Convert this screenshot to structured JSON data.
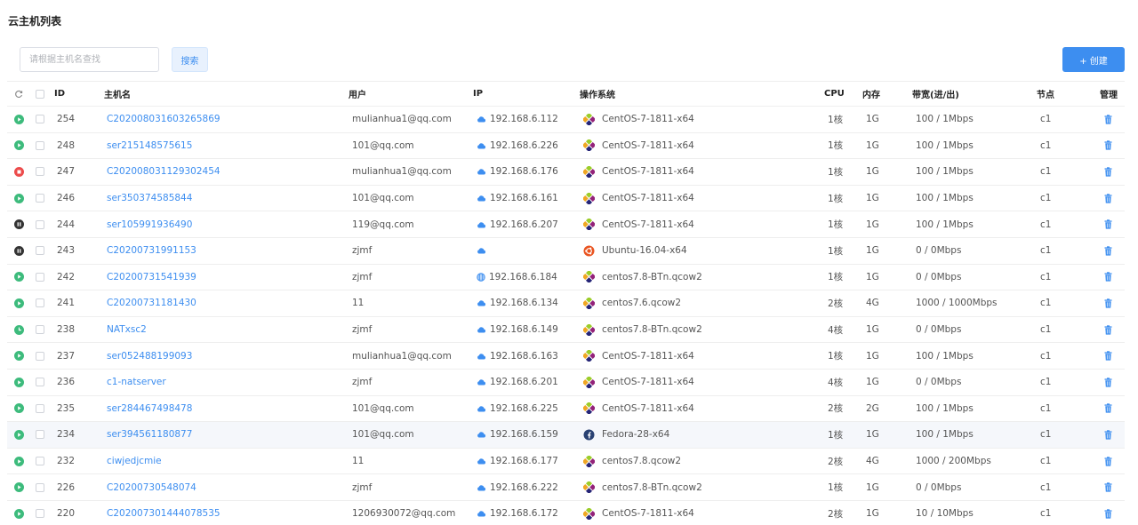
{
  "page": {
    "title": "云主机列表"
  },
  "toolbar": {
    "search_placeholder": "请根据主机名查找",
    "search_value": "",
    "search_label": "搜索",
    "create_label": "+ 创建"
  },
  "columns": {
    "id": "ID",
    "name": "主机名",
    "user": "用户",
    "ip": "IP",
    "os": "操作系统",
    "cpu": "CPU",
    "mem": "内存",
    "bandwidth": "带宽(进/出)",
    "node": "节点",
    "manage": "管理"
  },
  "colors": {
    "accent": "#3d8ef0",
    "running": "#3dbb7c",
    "stopped": "#ec4b4b",
    "paused": "#333333"
  },
  "rows": [
    {
      "status": "running",
      "id": "254",
      "name": "C202008031603265869",
      "user": "mulianhua1@qq.com",
      "ip_icon": "cloud-icon",
      "ip": "192.168.6.112",
      "os_icon": "centos-logo-icon",
      "os": "CentOS-7-1811-x64",
      "cpu": "1核",
      "mem": "1G",
      "bandwidth": "100 / 1Mbps",
      "node": "c1"
    },
    {
      "status": "running",
      "id": "248",
      "name": "ser215148575615",
      "user": "101@qq.com",
      "ip_icon": "cloud-icon",
      "ip": "192.168.6.226",
      "os_icon": "centos-logo-icon",
      "os": "CentOS-7-1811-x64",
      "cpu": "1核",
      "mem": "1G",
      "bandwidth": "100 / 1Mbps",
      "node": "c1"
    },
    {
      "status": "stopped",
      "id": "247",
      "name": "C202008031129302454",
      "user": "mulianhua1@qq.com",
      "ip_icon": "cloud-icon",
      "ip": "192.168.6.176",
      "os_icon": "centos-logo-icon",
      "os": "CentOS-7-1811-x64",
      "cpu": "1核",
      "mem": "1G",
      "bandwidth": "100 / 1Mbps",
      "node": "c1"
    },
    {
      "status": "running",
      "id": "246",
      "name": "ser350374585844",
      "user": "101@qq.com",
      "ip_icon": "cloud-icon",
      "ip": "192.168.6.161",
      "os_icon": "centos-logo-icon",
      "os": "CentOS-7-1811-x64",
      "cpu": "1核",
      "mem": "1G",
      "bandwidth": "100 / 1Mbps",
      "node": "c1"
    },
    {
      "status": "paused",
      "id": "244",
      "name": "ser105991936490",
      "user": "119@qq.com",
      "ip_icon": "cloud-icon",
      "ip": "192.168.6.207",
      "os_icon": "centos-logo-icon",
      "os": "CentOS-7-1811-x64",
      "cpu": "1核",
      "mem": "1G",
      "bandwidth": "100 / 1Mbps",
      "node": "c1"
    },
    {
      "status": "paused",
      "id": "243",
      "name": "C20200731991153",
      "user": "zjmf",
      "ip_icon": "cloud-icon",
      "ip": "",
      "os_icon": "ubuntu-logo-icon",
      "os": "Ubuntu-16.04-x64",
      "cpu": "1核",
      "mem": "1G",
      "bandwidth": "0 / 0Mbps",
      "node": "c1"
    },
    {
      "status": "running",
      "id": "242",
      "name": "C20200731541939",
      "user": "zjmf",
      "ip_icon": "globe-icon",
      "ip": "192.168.6.184",
      "os_icon": "centos-logo-icon",
      "os": "centos7.8-BTn.qcow2",
      "cpu": "1核",
      "mem": "1G",
      "bandwidth": "0 / 0Mbps",
      "node": "c1"
    },
    {
      "status": "running",
      "id": "241",
      "name": "C20200731181430",
      "user": "11",
      "ip_icon": "cloud-icon",
      "ip": "192.168.6.134",
      "os_icon": "centos-logo-icon",
      "os": "centos7.6.qcow2",
      "cpu": "2核",
      "mem": "4G",
      "bandwidth": "1000 / 1000Mbps",
      "node": "c1"
    },
    {
      "status": "pending",
      "id": "238",
      "name": "NATxsc2",
      "user": "zjmf",
      "ip_icon": "cloud-icon",
      "ip": "192.168.6.149",
      "os_icon": "centos-logo-icon",
      "os": "centos7.8-BTn.qcow2",
      "cpu": "4核",
      "mem": "1G",
      "bandwidth": "0 / 0Mbps",
      "node": "c1"
    },
    {
      "status": "running",
      "id": "237",
      "name": "ser052488199093",
      "user": "mulianhua1@qq.com",
      "ip_icon": "cloud-icon",
      "ip": "192.168.6.163",
      "os_icon": "centos-logo-icon",
      "os": "CentOS-7-1811-x64",
      "cpu": "1核",
      "mem": "1G",
      "bandwidth": "100 / 1Mbps",
      "node": "c1"
    },
    {
      "status": "running",
      "id": "236",
      "name": "c1-natserver",
      "user": "zjmf",
      "ip_icon": "cloud-icon",
      "ip": "192.168.6.201",
      "os_icon": "centos-logo-icon",
      "os": "CentOS-7-1811-x64",
      "cpu": "4核",
      "mem": "1G",
      "bandwidth": "0 / 0Mbps",
      "node": "c1"
    },
    {
      "status": "running",
      "id": "235",
      "name": "ser284467498478",
      "user": "101@qq.com",
      "ip_icon": "cloud-icon",
      "ip": "192.168.6.225",
      "os_icon": "centos-logo-icon",
      "os": "CentOS-7-1811-x64",
      "cpu": "2核",
      "mem": "2G",
      "bandwidth": "100 / 1Mbps",
      "node": "c1"
    },
    {
      "status": "running",
      "id": "234",
      "name": "ser394561180877",
      "user": "101@qq.com",
      "ip_icon": "cloud-icon",
      "ip": "192.168.6.159",
      "os_icon": "fedora-logo-icon",
      "os": "Fedora-28-x64",
      "cpu": "1核",
      "mem": "1G",
      "bandwidth": "100 / 1Mbps",
      "node": "c1",
      "highlight": true
    },
    {
      "status": "running",
      "id": "232",
      "name": "ciwjedjcmie",
      "user": "11",
      "ip_icon": "cloud-icon",
      "ip": "192.168.6.177",
      "os_icon": "centos-logo-icon",
      "os": "centos7.8.qcow2",
      "cpu": "2核",
      "mem": "4G",
      "bandwidth": "1000 / 200Mbps",
      "node": "c1"
    },
    {
      "status": "running",
      "id": "226",
      "name": "C20200730548074",
      "user": "zjmf",
      "ip_icon": "cloud-icon",
      "ip": "192.168.6.222",
      "os_icon": "centos-logo-icon",
      "os": "centos7.8-BTn.qcow2",
      "cpu": "1核",
      "mem": "1G",
      "bandwidth": "0 / 0Mbps",
      "node": "c1"
    },
    {
      "status": "running",
      "id": "220",
      "name": "C202007301444078535",
      "user": "1206930072@qq.com",
      "ip_icon": "cloud-icon",
      "ip": "192.168.6.172",
      "os_icon": "centos-logo-icon",
      "os": "CentOS-7-1811-x64",
      "cpu": "2核",
      "mem": "1G",
      "bandwidth": "10 / 10Mbps",
      "node": "c1"
    }
  ]
}
